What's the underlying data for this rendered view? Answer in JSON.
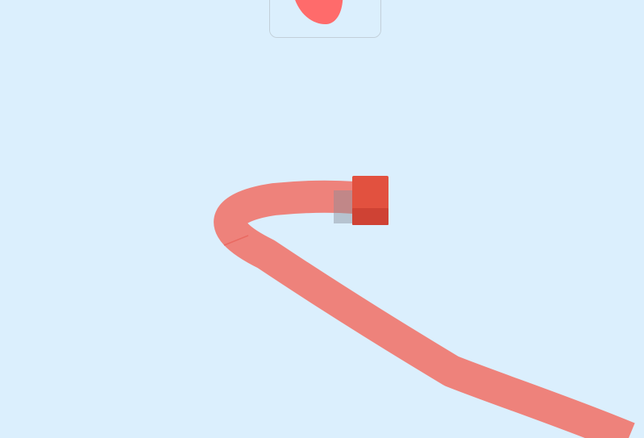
{
  "colors": {
    "background": "#dbeffd",
    "trail": "#ee827b",
    "trail_seam": "#e96a62",
    "cube_top": "#e2513f",
    "cube_front": "#cf4234",
    "cube_shadow": "#8a8f9a",
    "card_bg": "#dbeffd",
    "card_border": "#c2cfd9",
    "blob": "#ff6b6b"
  },
  "preview": {
    "icon": "red-blob-icon"
  },
  "player": {
    "icon": "red-cube-icon"
  },
  "trail": {
    "icon": "paint-trail"
  }
}
